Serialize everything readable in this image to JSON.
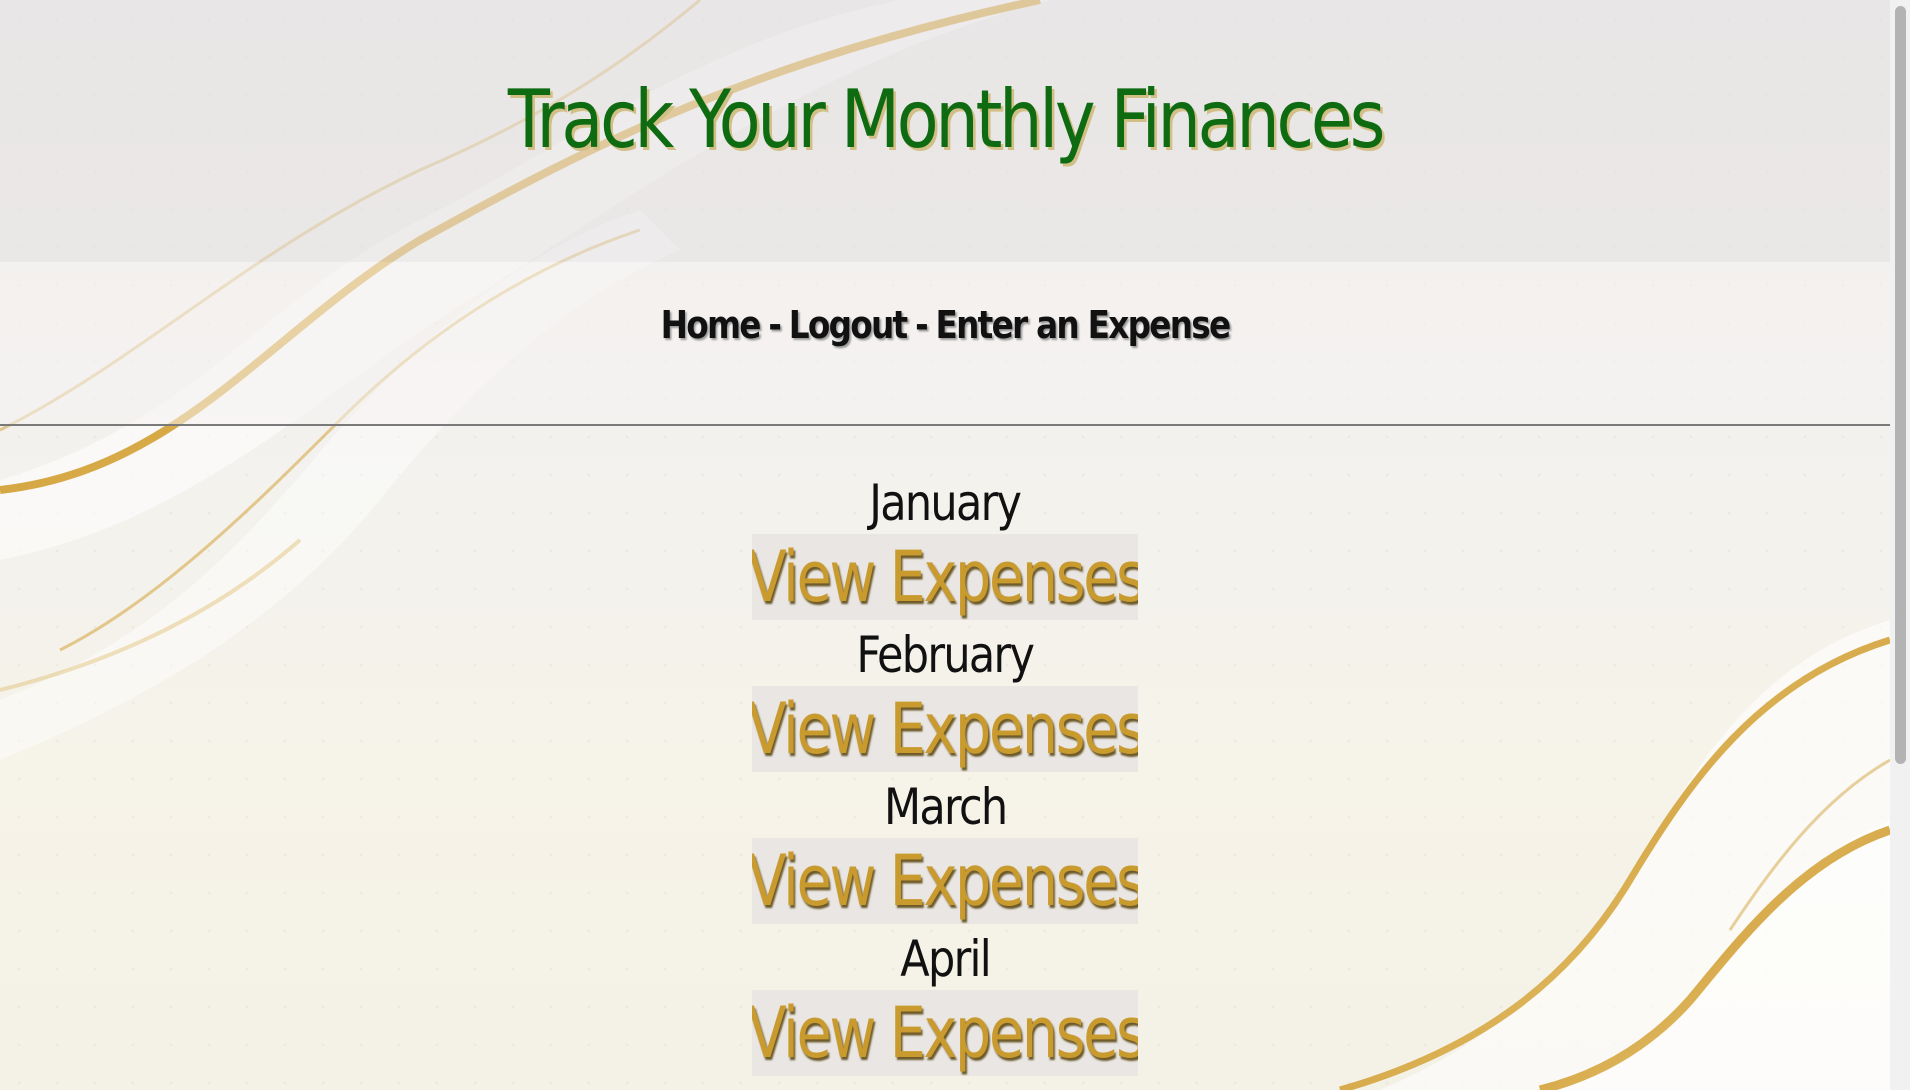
{
  "page": {
    "title": "Track Your Monthly Finances"
  },
  "nav": {
    "home": "Home",
    "logout": "Logout",
    "enter_expense": "Enter an Expense",
    "separator": "-"
  },
  "months": [
    {
      "name": "January",
      "button": "View Expenses"
    },
    {
      "name": "February",
      "button": "View Expenses"
    },
    {
      "name": "March",
      "button": "View Expenses"
    },
    {
      "name": "April",
      "button": "View Expenses"
    }
  ],
  "colors": {
    "title": "#0f6b12",
    "button_text": "#c99a2e",
    "gold_accent": "#d9a93a"
  }
}
